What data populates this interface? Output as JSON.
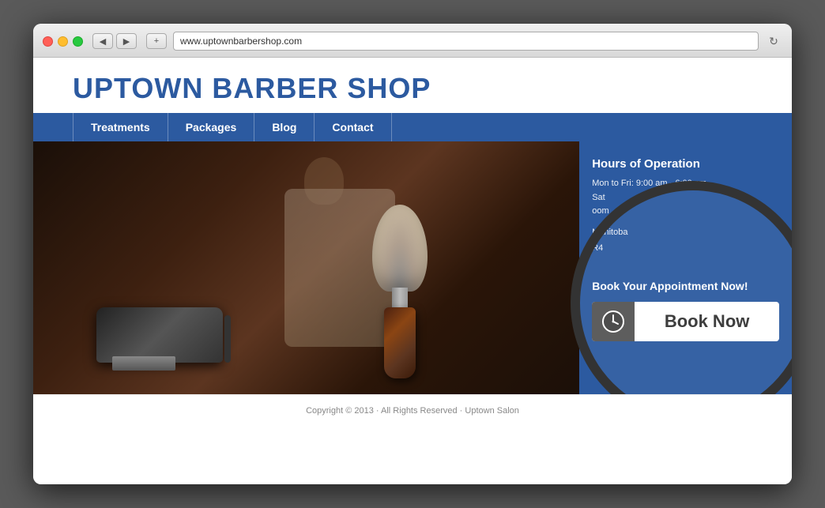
{
  "browser": {
    "url": "www.uptownbarbershop.com",
    "back_label": "◀",
    "forward_label": "▶",
    "plus_label": "+"
  },
  "site": {
    "title": "UPTOWN BARBER SHOP",
    "nav": {
      "items": [
        {
          "label": "Treatments"
        },
        {
          "label": "Packages"
        },
        {
          "label": "Blog"
        },
        {
          "label": "Contact"
        }
      ]
    },
    "sidebar": {
      "hours_title": "Hours of Operation",
      "hours_line1": "Mon to Fri: 9:00 am - 6:00 pm",
      "hours_line2": "Sat",
      "hours_line3": "oom",
      "address_line1": "Manitoba",
      "address_line2": "R4"
    },
    "booking": {
      "title": "Book Your Appointment Now!",
      "button_label": "Book Now"
    },
    "footer": {
      "text": "Copyright © 2013 · All Rights Reserved · Uptown Salon"
    }
  }
}
